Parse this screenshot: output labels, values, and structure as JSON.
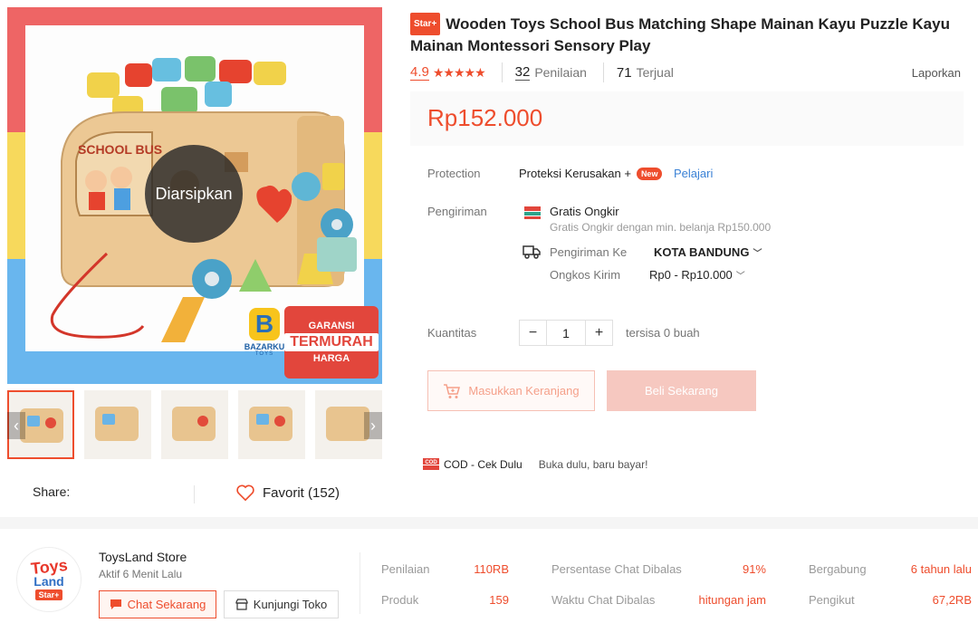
{
  "gallery": {
    "overlay_text": "Diarsipkan",
    "guarantee_line1": "GARANSI",
    "guarantee_line2": "TERMURAH",
    "guarantee_line3": "HARGA",
    "brand_initial": "B",
    "brand_name": "BAZARKU",
    "brand_sub": "TOYS",
    "prev_arrow": "‹",
    "next_arrow": "›"
  },
  "share_label": "Share:",
  "favorite_label": "Favorit (152)",
  "product": {
    "badge": "Star+",
    "title": "Wooden Toys School Bus Matching Shape Mainan Kayu Puzzle Kayu Mainan Montessori Sensory Play",
    "rating": "4.9",
    "stars": "★★★★★",
    "review_count": "32",
    "review_label": "Penilaian",
    "sold_count": "71",
    "sold_label": "Terjual",
    "report_label": "Laporkan",
    "price": "Rp152.000"
  },
  "protection": {
    "label": "Protection",
    "text": "Proteksi Kerusakan +",
    "new_badge": "New",
    "learn_link": "Pelajari"
  },
  "shipping": {
    "label": "Pengiriman",
    "free_title": "Gratis Ongkir",
    "free_sub": "Gratis Ongkir dengan min. belanja Rp150.000",
    "ship_to_label": "Pengiriman Ke",
    "ship_to_value": "KOTA BANDUNG",
    "cost_label": "Ongkos Kirim",
    "cost_value": "Rp0 - Rp10.000"
  },
  "quantity": {
    "label": "Kuantitas",
    "minus": "−",
    "value": "1",
    "plus": "+",
    "stock": "tersisa 0 buah"
  },
  "actions": {
    "cart_label": "Masukkan Keranjang",
    "buy_label": "Beli Sekarang"
  },
  "cod": {
    "title": "COD - Cek Dulu",
    "subtitle": "Buka dulu, baru bayar!"
  },
  "store": {
    "logo_line1": "Toys",
    "logo_line2": "Land",
    "logo_badge": "Star+",
    "name": "ToysLand Store",
    "active": "Aktif 6 Menit Lalu",
    "chat_label": "Chat Sekarang",
    "visit_label": "Kunjungi Toko",
    "stats": [
      {
        "label": "Penilaian",
        "value": "110RB"
      },
      {
        "label": "Produk",
        "value": "159"
      },
      {
        "label": "Persentase Chat Dibalas",
        "value": "91%"
      },
      {
        "label": "Waktu Chat Dibalas",
        "value": "hitungan jam"
      },
      {
        "label": "Bergabung",
        "value": "6 tahun lalu"
      },
      {
        "label": "Pengikut",
        "value": "67,2RB"
      }
    ]
  },
  "colors": {
    "accent": "#ee4d2d",
    "link": "#3b82d6"
  }
}
